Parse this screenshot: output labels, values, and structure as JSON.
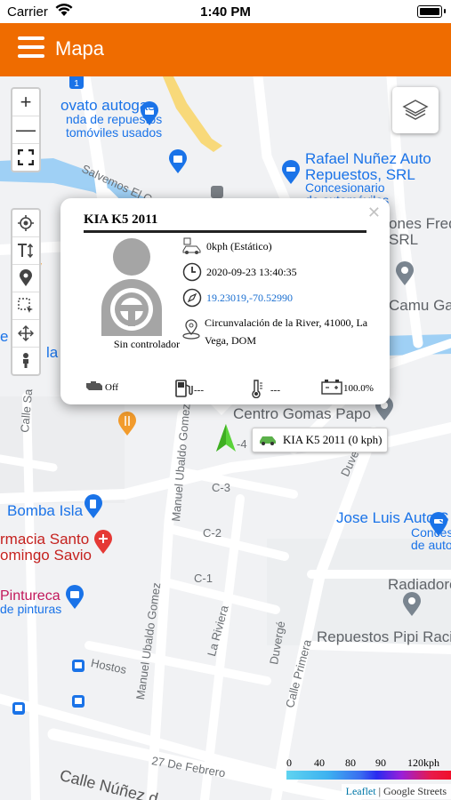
{
  "status_bar": {
    "carrier": "Carrier",
    "time": "1:40 PM"
  },
  "app_bar": {
    "title": "Mapa"
  },
  "map_controls": {
    "zoom_in": "+",
    "zoom_out": "—"
  },
  "map_labels": {
    "novato_1": "ovato autogas",
    "novato_2": "nda de repuestos",
    "novato_3": "tomóviles usados",
    "rafael_1": "Rafael Nuñez Auto",
    "rafael_2": "Repuestos, SRL",
    "rafael_3": "Concesionario",
    "rafael_4": "de automóviles",
    "salvemos": "Salvemos El Camu",
    "freddy_1": "ones Fred",
    "freddy_2": "SRL",
    "camu_gas": "Camu Gas",
    "centro_gomas": "Centro Gomas Papo",
    "bomba_isla": "Bomba Isla",
    "farmacia_1": "rmacia Santo",
    "farmacia_2": "omingo Savio",
    "pintureca_1": "Pintureca",
    "pintureca_2": "de pinturas",
    "jose_luis": "Jose Luis Auto S",
    "conces_1": "Conces",
    "conces_2": "de autor",
    "radiadore": "Radiadore",
    "pipi": "Repuestos Pipi Raci",
    "w_label": "r W",
    "p_label_1": "e p",
    "p_label_2": "la",
    "calle_sa": "Calle Sa",
    "manuel_1": "Manuel Ubaldo Gomez",
    "manuel_2": "Manuel Ubaldo Gomez",
    "la_riviera": "La Riviera",
    "duverge_1": "Duvergé",
    "duverge_2": "Duvergé",
    "calle_primera": "Calle Primera",
    "hostos": "Hostos",
    "c3": "C-3",
    "c2": "C-2",
    "c1": "C-1",
    "c4": "-4",
    "febrero": "27 De Febrero",
    "calle_nunez": "Calle Núñez d"
  },
  "popup": {
    "title": "KIA K5 2011",
    "driver": "Sin controlador",
    "speed": "0kph (Estático)",
    "datetime": "2020-09-23 13:40:35",
    "coords": "19.23019,-70.52990",
    "address": "Circunvalación de la River, 41000, La Vega, DOM",
    "engine": "Off",
    "fuel": "---",
    "temperature": "---",
    "battery": "100.0%"
  },
  "vehicle_label": "KIA K5 2011 (0 kph)",
  "speed_legend": {
    "ticks": [
      "0",
      "40",
      "80",
      "90",
      "120kph"
    ]
  },
  "attribution": {
    "leaflet": "Leaflet",
    "separator": " | ",
    "google": "Google Streets"
  },
  "colors": {
    "app_bar": "#ef6c00",
    "water": "#9fd0f5",
    "vehicle_marker": "#5bd33a"
  }
}
